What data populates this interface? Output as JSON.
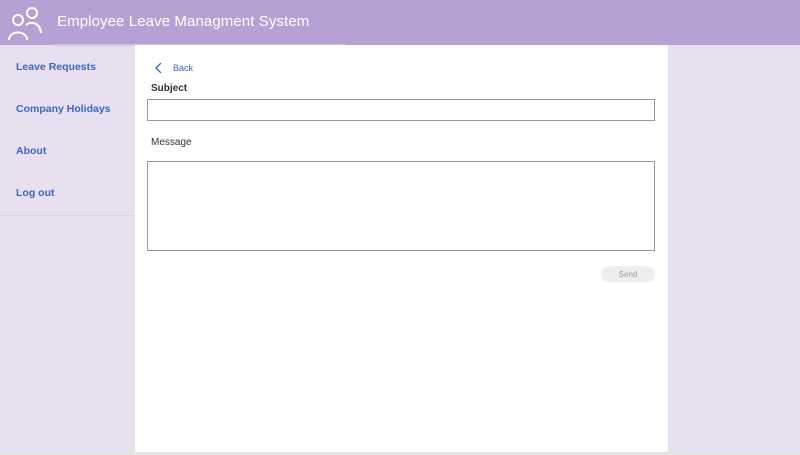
{
  "header": {
    "title": "Employee Leave Managment System",
    "logo_icon": "people-icon",
    "background": "#b7a1d4"
  },
  "sidebar": {
    "items": [
      {
        "label": "Leave Requests"
      },
      {
        "label": "Company Holidays"
      },
      {
        "label": "About"
      },
      {
        "label": "Log out"
      }
    ]
  },
  "form": {
    "back_label": "Back",
    "back_icon": "chevron-left-icon",
    "subject_label": "Subject",
    "subject_value": "",
    "message_label": "Message",
    "message_value": "",
    "send_label": "Send"
  },
  "colors": {
    "accent_link": "#3b66c4",
    "page_background": "#e8dff0"
  }
}
